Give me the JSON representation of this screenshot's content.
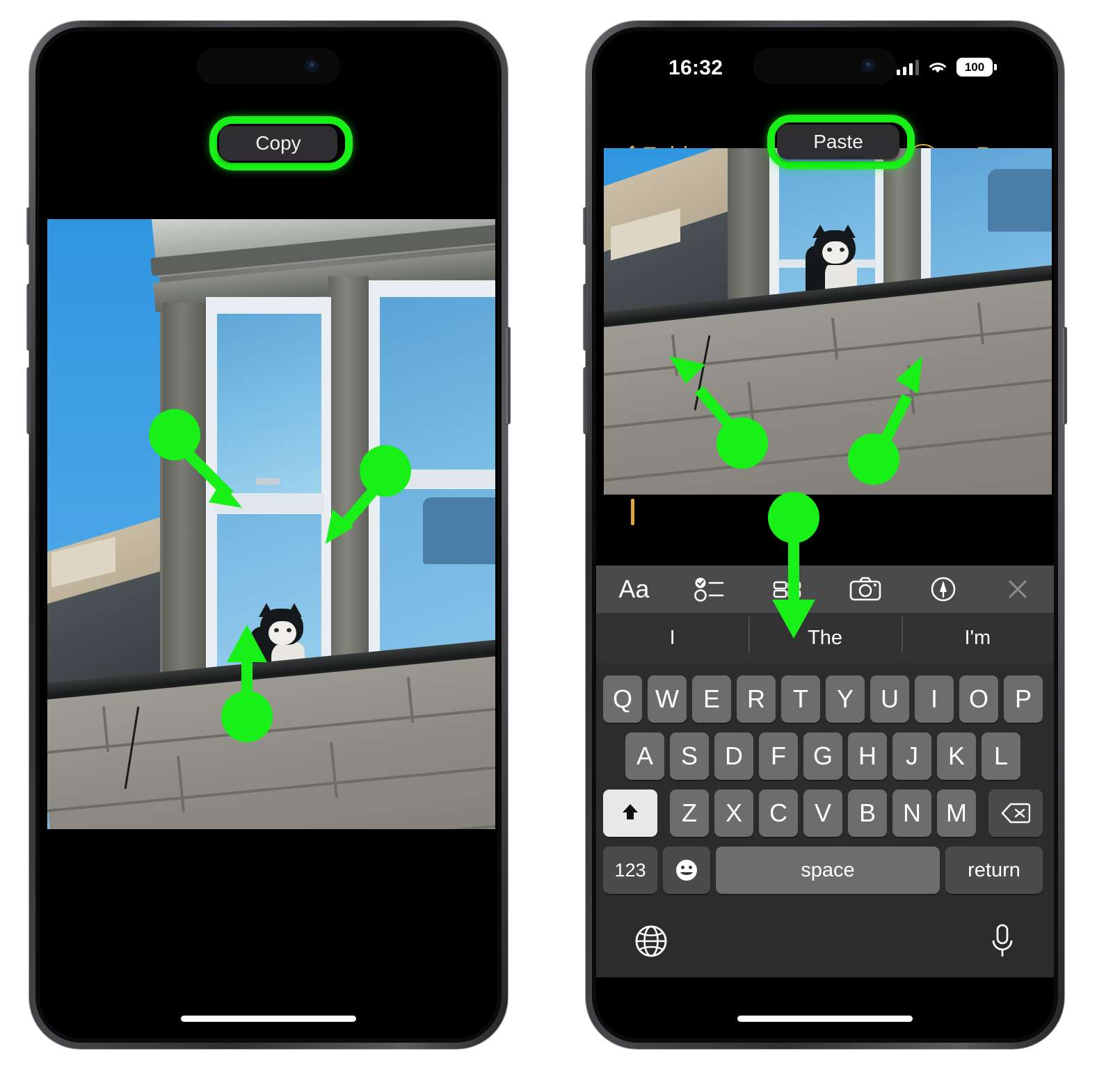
{
  "meta": {
    "accent_green": "#18F018",
    "ios_yellow": "#E8A33D",
    "screens": 2
  },
  "left_phone": {
    "name": "iPhone showing Photos app share menu",
    "context_menu": {
      "copy_label": "Copy",
      "highlighted": true
    },
    "photo": {
      "description": "Black and white cat sitting on a window ledge of a grey stone building under blue sky",
      "alt": "cat-on-window-ledge"
    },
    "annotations": [
      {
        "type": "tap-arrow",
        "target": "left-window-pane"
      },
      {
        "type": "tap-arrow",
        "target": "right-window-pane"
      },
      {
        "type": "tap-arrow",
        "target": "cat-on-ledge"
      }
    ]
  },
  "right_phone": {
    "name": "iPhone showing Notes app with pasted image",
    "status_bar": {
      "time": "16:32",
      "signal_bars": 3,
      "signal_bars_total": 4,
      "wifi": true,
      "battery_percent": "100"
    },
    "nav_bar": {
      "back_label": "Folders",
      "back_icon": "chevron-left-icon",
      "more_icon": "ellipsis-circle-icon",
      "done_label": "Done"
    },
    "context_menu": {
      "paste_label": "Paste",
      "highlighted": true
    },
    "note": {
      "pasted_image_alt": "cat-on-window-ledge",
      "text_cursor_visible": true,
      "body_text": ""
    },
    "keyboard": {
      "toolbar_icons": [
        {
          "name": "format-icon",
          "label": "Aa"
        },
        {
          "name": "checklist-icon",
          "label": ""
        },
        {
          "name": "table-icon",
          "label": ""
        },
        {
          "name": "camera-icon",
          "label": ""
        },
        {
          "name": "markup-pen-icon",
          "label": ""
        },
        {
          "name": "close-icon",
          "label": ""
        }
      ],
      "predictions": [
        "I",
        "The",
        "I'm"
      ],
      "row1": [
        "Q",
        "W",
        "E",
        "R",
        "T",
        "Y",
        "U",
        "I",
        "O",
        "P"
      ],
      "row2": [
        "A",
        "S",
        "D",
        "F",
        "G",
        "H",
        "J",
        "K",
        "L"
      ],
      "row3": [
        "Z",
        "X",
        "C",
        "V",
        "B",
        "N",
        "M"
      ],
      "shift_key": {
        "name": "shift-key",
        "active": true
      },
      "backspace_key": {
        "name": "backspace-key"
      },
      "numbers_key_label": "123",
      "emoji_key": {
        "name": "emoji-key"
      },
      "space_key_label": "space",
      "return_key_label": "return",
      "globe_key": {
        "name": "globe-icon"
      },
      "dictation_key": {
        "name": "microphone-icon"
      }
    },
    "annotations": [
      {
        "type": "tap-arrow",
        "target": "image-left-edge"
      },
      {
        "type": "tap-arrow",
        "target": "image-right-edge"
      },
      {
        "type": "tap-arrow",
        "target": "table-toolbar-icon"
      }
    ]
  }
}
